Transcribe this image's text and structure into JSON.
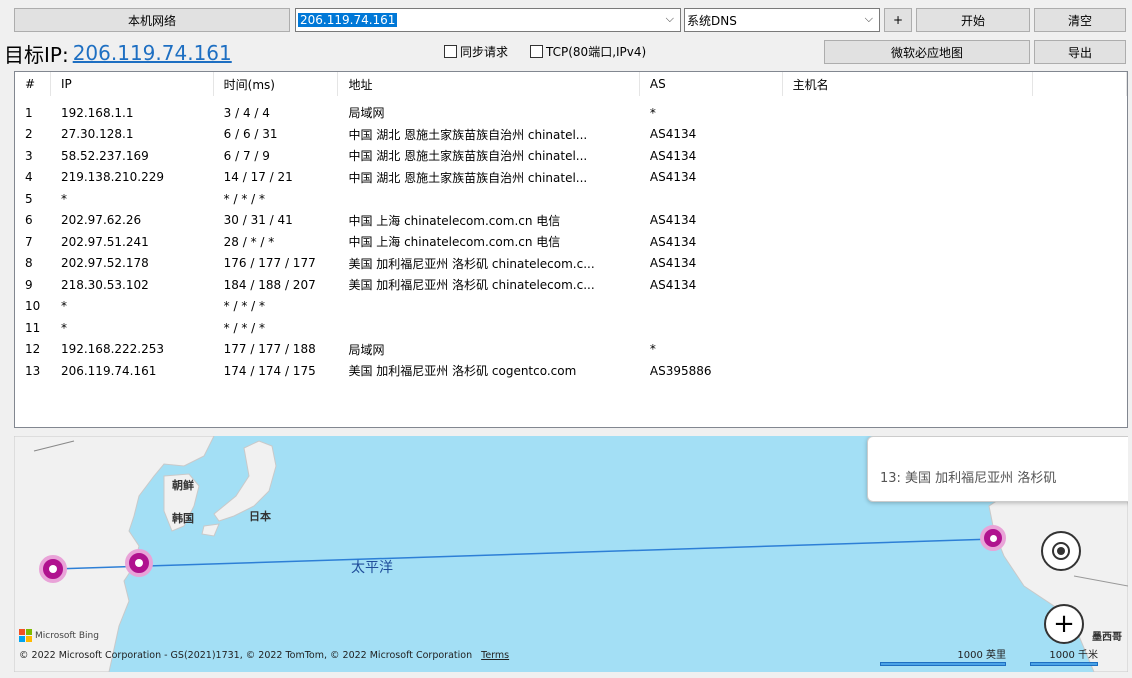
{
  "toolbar": {
    "local_network_label": "本机网络",
    "target_value": "206.119.74.161",
    "dns_value": "系统DNS",
    "plus_label": "+",
    "start_label": "开始",
    "clear_label": "清空",
    "map_label": "微软必应地图",
    "export_label": "导出"
  },
  "target": {
    "label": "目标IP:",
    "ip": "206.119.74.161"
  },
  "options": {
    "sync_label": "同步请求",
    "tcp_label": "TCP(80端口,IPv4)",
    "sync_checked": false,
    "tcp_checked": false
  },
  "table": {
    "headers": [
      "#",
      "IP",
      "时间(ms)",
      "地址",
      "AS",
      "主机名",
      ""
    ],
    "rows": [
      [
        "1",
        "192.168.1.1",
        "3 / 4 / 4",
        "局域网",
        "*",
        "",
        ""
      ],
      [
        "2",
        "27.30.128.1",
        "6 / 6 / 31",
        "中国 湖北 恩施土家族苗族自治州 chinatel...",
        "AS4134",
        "",
        ""
      ],
      [
        "3",
        "58.52.237.169",
        "6 / 7 / 9",
        "中国 湖北 恩施土家族苗族自治州 chinatel...",
        "AS4134",
        "",
        ""
      ],
      [
        "4",
        "219.138.210.229",
        "14 / 17 / 21",
        "中国 湖北 恩施土家族苗族自治州 chinatel...",
        "AS4134",
        "",
        ""
      ],
      [
        "5",
        "*",
        "* / * / *",
        "",
        "",
        "",
        ""
      ],
      [
        "6",
        "202.97.62.26",
        "30 / 31 / 41",
        "中国 上海 chinatelecom.com.cn 电信",
        "AS4134",
        "",
        ""
      ],
      [
        "7",
        "202.97.51.241",
        "28 / * / *",
        "中国 上海 chinatelecom.com.cn 电信",
        "AS4134",
        "",
        ""
      ],
      [
        "8",
        "202.97.52.178",
        "176 / 177 / 177",
        "美国 加利福尼亚州 洛杉矶 chinatelecom.c...",
        "AS4134",
        "",
        ""
      ],
      [
        "9",
        "218.30.53.102",
        "184 / 188 / 207",
        "美国 加利福尼亚州 洛杉矶 chinatelecom.c...",
        "AS4134",
        "",
        ""
      ],
      [
        "10",
        "*",
        "* / * / *",
        "",
        "",
        "",
        ""
      ],
      [
        "11",
        "*",
        "* / * / *",
        "",
        "",
        "",
        ""
      ],
      [
        "12",
        "192.168.222.253",
        "177 / 177 / 188",
        "局域网",
        "*",
        "",
        ""
      ],
      [
        "13",
        "206.119.74.161",
        "174 / 174 / 175",
        "美国 加利福尼亚州 洛杉矶 cogentco.com",
        "AS395886",
        "",
        ""
      ]
    ]
  },
  "map": {
    "popup_text": "13: 美国 加利福尼亚州 洛杉矶",
    "labels": {
      "korea_north": "朝鲜",
      "korea_south": "韩国",
      "japan": "日本",
      "mexico": "墨西哥"
    },
    "ocean_label": "太平洋",
    "bing_text": "Microsoft Bing",
    "copyright": "© 2022 Microsoft Corporation - GS(2021)1731, © 2022 TomTom, © 2022 Microsoft Corporation",
    "terms": "Terms",
    "scale_miles": "1000 英里",
    "scale_km": "1000 千米",
    "marker_color": "#b0128f",
    "route_color": "#2d7fd6",
    "ocean_color": "#a3dff5",
    "land_color": "#f1f1f1"
  }
}
